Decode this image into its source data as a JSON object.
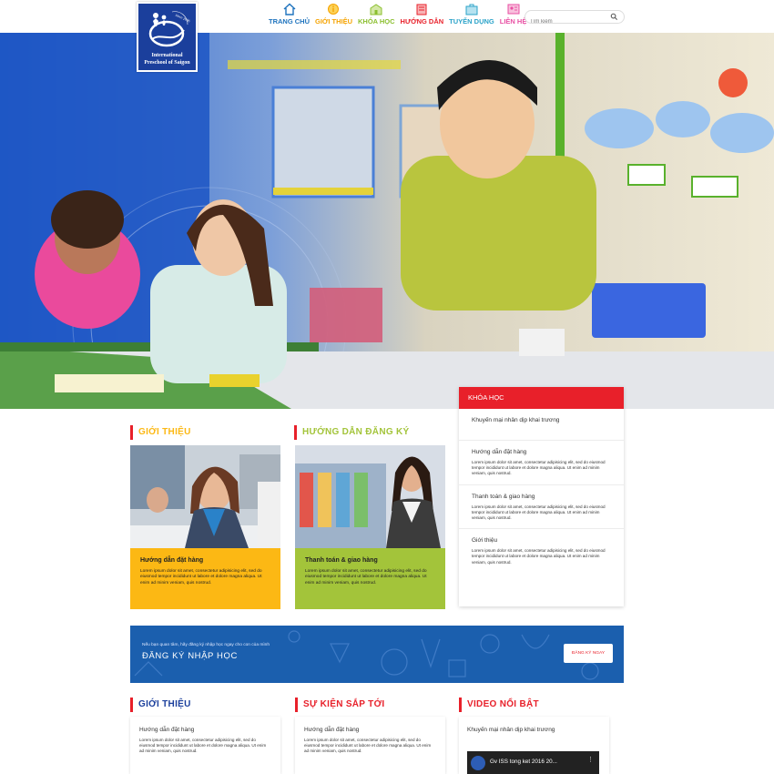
{
  "logo": {
    "tagline": "since 2006",
    "line1": "International",
    "line2": "Preschool of Saigon"
  },
  "nav": [
    {
      "label": "TRANG CHỦ",
      "icon": "home-icon",
      "color": "#1e73be"
    },
    {
      "label": "GIỚI THIỆU",
      "icon": "info-icon",
      "color": "#f5a300"
    },
    {
      "label": "KHÓA HỌC",
      "icon": "school-icon",
      "color": "#8bbf2f"
    },
    {
      "label": "HƯỚNG DẪN",
      "icon": "book-icon",
      "color": "#e8202a"
    },
    {
      "label": "TUYỂN DỤNG",
      "icon": "briefcase-icon",
      "color": "#2ba3c9"
    },
    {
      "label": "LIÊN HỆ",
      "icon": "contact-icon",
      "color": "#e84fa3"
    }
  ],
  "search": {
    "placeholder": "Tìm kiếm"
  },
  "sections": {
    "intro_title": "GIỚI THIỆU",
    "guide_title": "HƯỚNG DẪN ĐĂNG KÝ"
  },
  "cards": [
    {
      "title": "Hướng dẫn đặt hàng",
      "text": "Lorem ipsum dolor sit amet, consectetur adipisicing elit, sed do eiusmod tempor incididunt ut labore et dolore magna aliqua. Ut enim ad minim veniam, quis nostrud."
    },
    {
      "title": "Thanh toán & giao hàng",
      "text": "Lorem ipsum dolor sit amet, consectetur adipisicing elit, sed do eiusmod tempor incididunt ut labore et dolore magna aliqua. Ut enim ad minim veniam, quis nostrud."
    }
  ],
  "courses": {
    "title": "KHÓA HỌC",
    "items": [
      {
        "title": "Khuyến mại nhân dịp khai trương",
        "text": ""
      },
      {
        "title": "Hướng dẫn đặt hàng",
        "text": "Lorem ipsum dolor sit amet, consectetur adipisicing elit, sed do eiusmod tempor incididunt ut labore et dolore magna aliqua. Ut enim ad minim veniam, quis nostrud."
      },
      {
        "title": "Thanh toán & giao hàng",
        "text": "Lorem ipsum dolor sit amet, consectetur adipisicing elit, sed do eiusmod tempor incididunt ut labore et dolore magna aliqua. Ut enim ad minim veniam, quis nostrud."
      },
      {
        "title": "Giới thiệu",
        "text": "Lorem ipsum dolor sit amet, consectetur adipisicing elit, sed do eiusmod tempor incididunt ut labore et dolore magna aliqua. Ut enim ad minim veniam, quis nostrud."
      }
    ]
  },
  "banner": {
    "small": "Nếu bạn quan tâm, hãy đăng ký nhập học ngay cho con của mình",
    "big": "ĐĂNG KÝ NHẬP HỌC",
    "button": "ĐĂNG KÝ NGAY"
  },
  "bottom": {
    "intro_title": "GIỚI THIỆU",
    "events_title": "SỰ KIỆN SẮP TỚI",
    "video_title": "VIDEO NỔI BẬT",
    "intro_card": {
      "title": "Hướng dẫn đặt hàng",
      "text": "Lorem ipsum dolor sit amet, consectetur adipisicing elit, sed do eiusmod tempor incididunt ut labore et dolore magna aliqua. Ut enim ad minim veniam, quis nostrud."
    },
    "events_card": {
      "title": "Hướng dẫn đặt hàng",
      "text": "Lorem ipsum dolor sit amet, consectetur adipisicing elit, sed do eiusmod tempor incididunt ut labore et dolore magna aliqua. Ut enim ad minim veniam, quis nostrud."
    },
    "video_card": {
      "title": "Khuyến mại nhân dịp khai trương",
      "video_label": "Gv ISS tong ket 2016 20..."
    }
  },
  "colors": {
    "red": "#e8202a",
    "yellow": "#fcb814",
    "green": "#a3c43a",
    "blue": "#1b5fae",
    "navy": "#1b3f9c"
  }
}
